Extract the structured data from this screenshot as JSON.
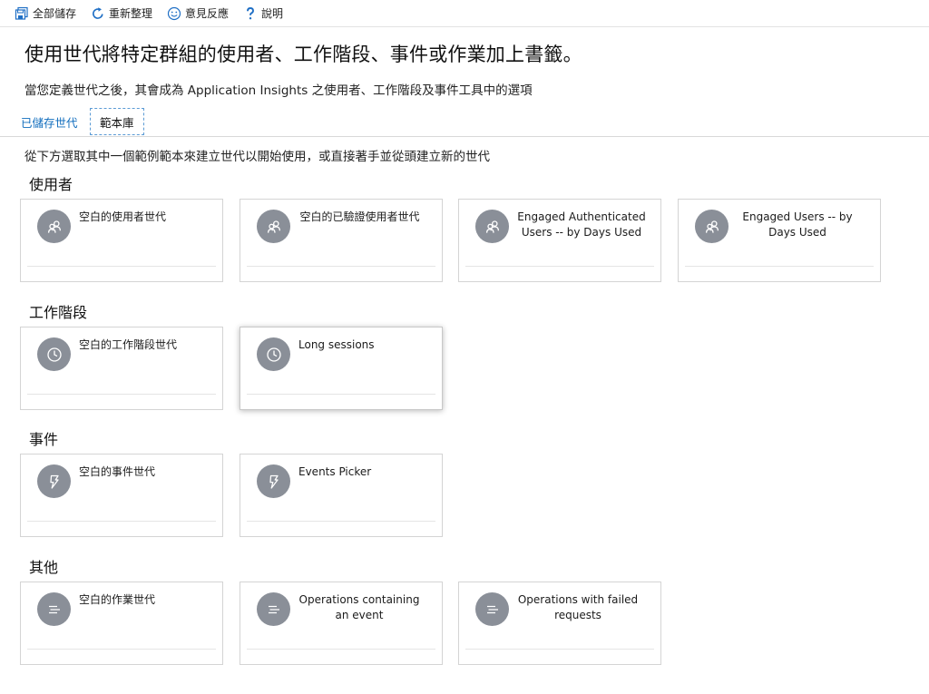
{
  "toolbar": {
    "save_all": "全部儲存",
    "refresh": "重新整理",
    "feedback": "意見反應",
    "help": "說明"
  },
  "page": {
    "title": "使用世代將特定群組的使用者、工作階段、事件或作業加上書籤。",
    "subtitle": "當您定義世代之後，其會成為 Application Insights 之使用者、工作階段及事件工具中的選項"
  },
  "tabs": {
    "saved": "已儲存世代",
    "library": "範本庫"
  },
  "instructions": "從下方選取其中一個範例範本來建立世代以開始使用，或直接著手並從頭建立新的世代",
  "sections": {
    "users": {
      "heading": "使用者",
      "cards": [
        {
          "label": "空白的使用者世代",
          "icon": "users-icon"
        },
        {
          "label": "空白的已驗證使用者世代",
          "icon": "users-icon"
        },
        {
          "label": "Engaged Authenticated Users -- by Days Used",
          "icon": "users-icon"
        },
        {
          "label": "Engaged Users -- by Days Used",
          "icon": "users-icon"
        }
      ]
    },
    "sessions": {
      "heading": "工作階段",
      "cards": [
        {
          "label": "空白的工作階段世代",
          "icon": "clock-icon"
        },
        {
          "label": "Long sessions",
          "icon": "clock-icon"
        }
      ]
    },
    "events": {
      "heading": "事件",
      "cards": [
        {
          "label": "空白的事件世代",
          "icon": "lightning-icon"
        },
        {
          "label": "Events Picker",
          "icon": "lightning-icon"
        }
      ]
    },
    "other": {
      "heading": "其他",
      "cards": [
        {
          "label": "空白的作業世代",
          "icon": "list-icon"
        },
        {
          "label": "Operations containing an event",
          "icon": "list-icon"
        },
        {
          "label": "Operations with failed requests",
          "icon": "list-icon"
        }
      ]
    }
  },
  "colors": {
    "accent": "#0f6cbd",
    "icon_circle": "#8a8f98",
    "card_border": "#d4d4d4"
  }
}
